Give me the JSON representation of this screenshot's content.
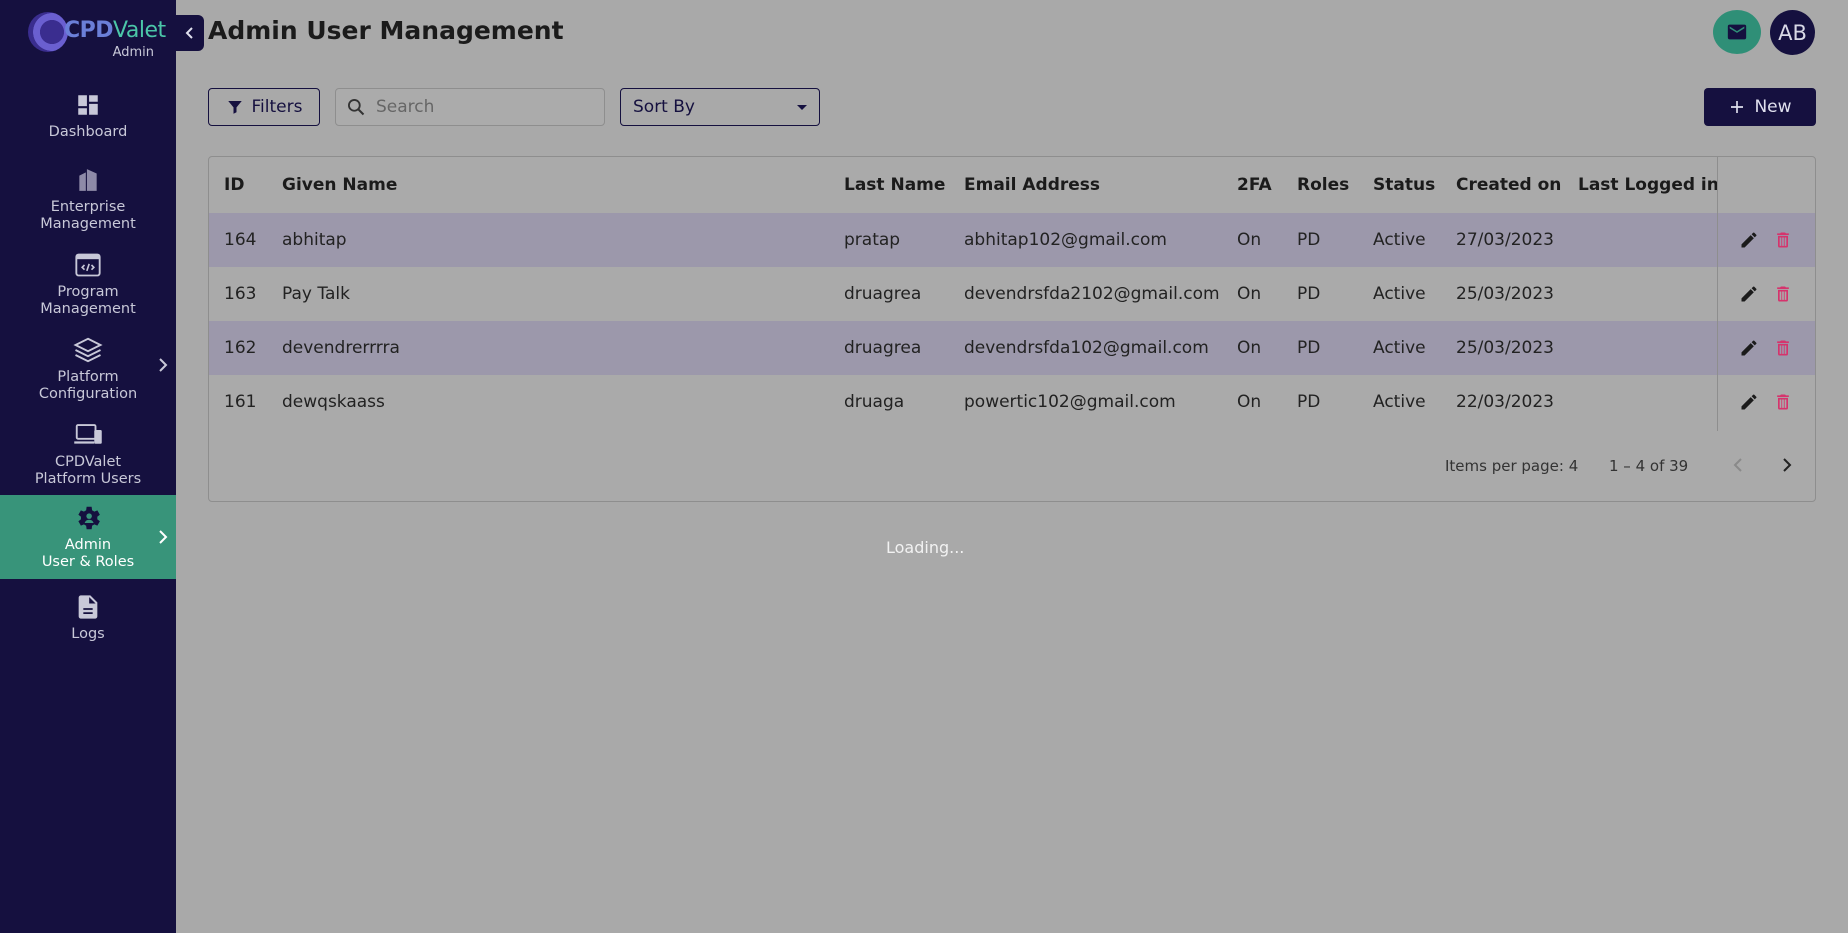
{
  "brand": {
    "name_main": "CPD",
    "name_accent": "Valet",
    "subtitle": "Admin"
  },
  "sidebar": {
    "items": [
      {
        "label": "Dashboard",
        "icon": "dashboard-icon"
      },
      {
        "label": "Enterprise\nManagement",
        "icon": "building-icon"
      },
      {
        "label": "Program\nManagement",
        "icon": "code-window-icon"
      },
      {
        "label": "Platform\nConfiguration",
        "icon": "layers-icon",
        "has_submenu": true
      },
      {
        "label": "CPDValet\nPlatform Users",
        "icon": "devices-icon"
      },
      {
        "label": "Admin\nUser & Roles",
        "icon": "admin-gear-icon",
        "has_submenu": true,
        "active": true
      },
      {
        "label": "Logs",
        "icon": "document-icon"
      }
    ]
  },
  "header": {
    "title": "Admin User Management",
    "avatar_initials": "AB"
  },
  "toolbar": {
    "filters_label": "Filters",
    "search_placeholder": "Search",
    "sort_label": "Sort By",
    "new_label": "New"
  },
  "table": {
    "columns": [
      "ID",
      "Given Name",
      "Last Name",
      "Email Address",
      "2FA",
      "Roles",
      "Status",
      "Created on",
      "Last Logged in"
    ],
    "rows": [
      {
        "id": "164",
        "given": "abhitap",
        "last": "pratap",
        "email": "abhitap102@gmail.com",
        "twofa": "On",
        "roles": "PD",
        "status": "Active",
        "created": "27/03/2023",
        "logged": ""
      },
      {
        "id": "163",
        "given": "Pay Talk",
        "last": "druagrea",
        "email": "devendrsfda2102@gmail.com",
        "twofa": "On",
        "roles": "PD",
        "status": "Active",
        "created": "25/03/2023",
        "logged": ""
      },
      {
        "id": "162",
        "given": "devendrerrrra",
        "last": "druagrea",
        "email": "devendrsfda102@gmail.com",
        "twofa": "On",
        "roles": "PD",
        "status": "Active",
        "created": "25/03/2023",
        "logged": ""
      },
      {
        "id": "161",
        "given": "dewqskaass",
        "last": "druaga",
        "email": "powertic102@gmail.com",
        "twofa": "On",
        "roles": "PD",
        "status": "Active",
        "created": "22/03/2023",
        "logged": ""
      }
    ]
  },
  "paginator": {
    "items_per_page_label": "Items per page: 4",
    "range_label": "1 – 4 of 39"
  },
  "loading_text": "Loading...",
  "colors": {
    "sidebar_bg": "#15103f",
    "active_bg": "#38947a",
    "delete_red": "#d6336c",
    "overlay": "#a9a9a9"
  }
}
